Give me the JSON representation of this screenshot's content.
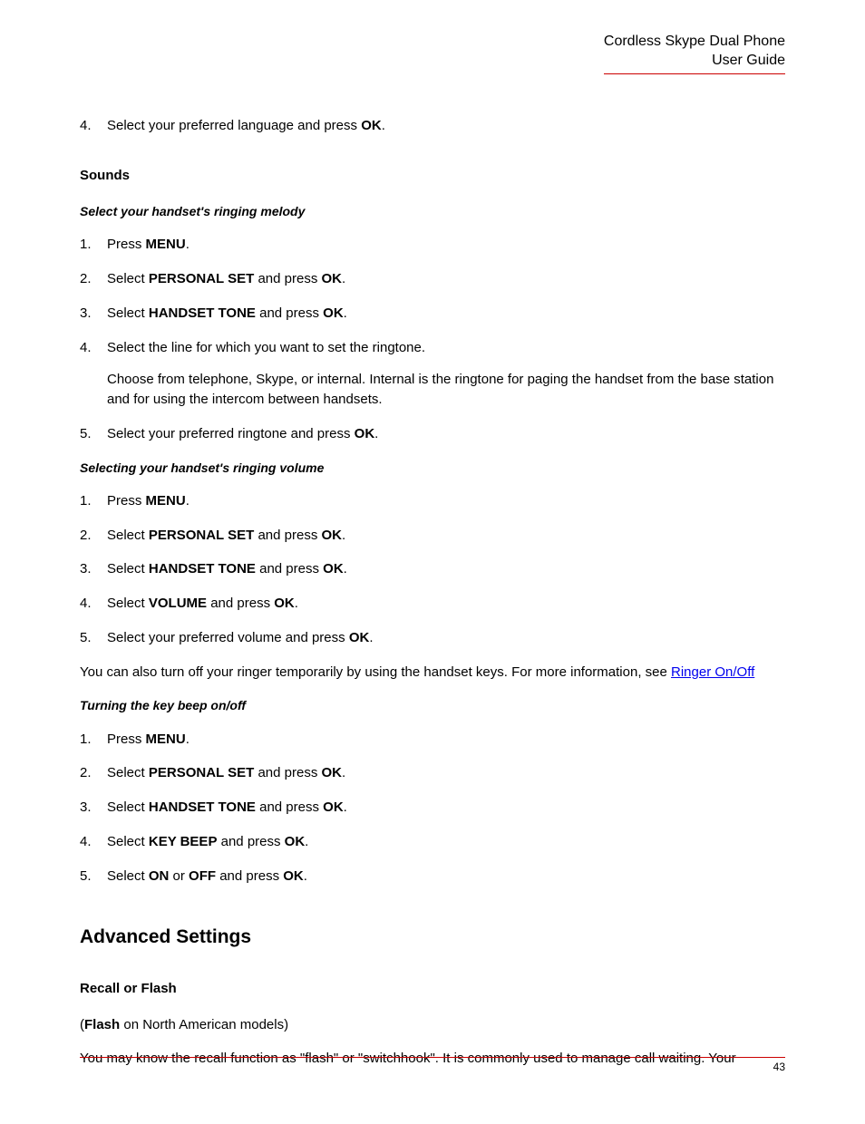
{
  "header": {
    "line1": "Cordless Skype Dual Phone",
    "line2": "User Guide"
  },
  "intro_step": {
    "num": "4.",
    "pre": "Select your preferred language and press ",
    "bold": "OK",
    "post": "."
  },
  "sounds": {
    "heading": "Sounds",
    "melody": {
      "heading": "Select your handset's ringing melody",
      "s1": {
        "num": "1.",
        "pre": "Press ",
        "b": "MENU",
        "post": "."
      },
      "s2": {
        "num": "2.",
        "pre": "Select ",
        "b": "PERSONAL SET",
        "mid": " and press ",
        "b2": "OK",
        "post": "."
      },
      "s3": {
        "num": "3.",
        "pre": "Select ",
        "b": "HANDSET TONE",
        "mid": " and press ",
        "b2": "OK",
        "post": "."
      },
      "s4": {
        "num": "4.",
        "line": "Select the line for which you want to set the ringtone.",
        "sub": "Choose from telephone, Skype, or internal. Internal is the ringtone for paging the handset from the base station and for using the intercom between handsets."
      },
      "s5": {
        "num": "5.",
        "pre": "Select your preferred ringtone and press ",
        "b": "OK",
        "post": "."
      }
    },
    "volume": {
      "heading": "Selecting your handset's ringing volume",
      "s1": {
        "num": "1.",
        "pre": "Press ",
        "b": "MENU",
        "post": "."
      },
      "s2": {
        "num": "2.",
        "pre": "Select ",
        "b": "PERSONAL SET",
        "mid": " and press ",
        "b2": "OK",
        "post": "."
      },
      "s3": {
        "num": "3.",
        "pre": "Select ",
        "b": "HANDSET TONE",
        "mid": " and press ",
        "b2": "OK",
        "post": "."
      },
      "s4": {
        "num": "4.",
        "pre": "Select ",
        "b": "VOLUME",
        "mid": " and press ",
        "b2": "OK",
        "post": "."
      },
      "s5": {
        "num": "5.",
        "pre": "Select your preferred volume and press ",
        "b": "OK",
        "post": "."
      },
      "note_pre": "You can also turn off your ringer temporarily by using the handset keys. For more information, see ",
      "note_link": "Ringer On/Off"
    },
    "beep": {
      "heading": "Turning the key beep on/off",
      "s1": {
        "num": "1.",
        "pre": "Press ",
        "b": "MENU",
        "post": "."
      },
      "s2": {
        "num": "2.",
        "pre": "Select ",
        "b": "PERSONAL SET",
        "mid": " and press ",
        "b2": "OK",
        "post": "."
      },
      "s3": {
        "num": "3.",
        "pre": "Select ",
        "b": "HANDSET TONE",
        "mid": " and press ",
        "b2": "OK",
        "post": "."
      },
      "s4": {
        "num": "4.",
        "pre": "Select ",
        "b": "KEY BEEP",
        "mid": " and press ",
        "b2": "OK",
        "post": "."
      },
      "s5": {
        "num": "5.",
        "pre": "Select ",
        "b": "ON",
        "mid1": " or ",
        "b2": "OFF",
        "mid2": " and press ",
        "b3": "OK",
        "post": "."
      }
    }
  },
  "advanced": {
    "heading": "Advanced Settings",
    "recall": {
      "heading": "Recall or Flash",
      "p1_pre": "(",
      "p1_b": "Flash",
      "p1_post": " on North American models)",
      "p2": "You may know the recall function as \"flash\" or \"switchhook\". It is commonly used to manage call waiting. Your"
    }
  },
  "footer": {
    "page": "43"
  }
}
